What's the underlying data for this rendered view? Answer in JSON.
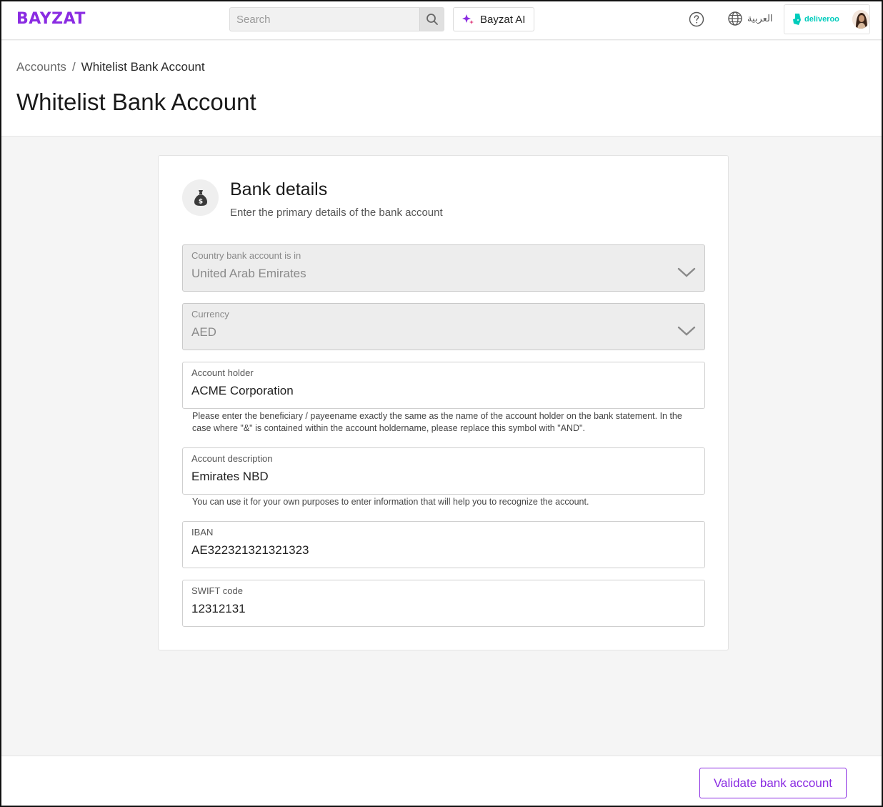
{
  "header": {
    "logo": "BAYZAT",
    "search_placeholder": "Search",
    "ai_label": "Bayzat AI",
    "language_label": "العربية",
    "company_name": "deliveroo"
  },
  "breadcrumb": {
    "parent": "Accounts",
    "separator": "/",
    "current": "Whitelist Bank Account"
  },
  "page": {
    "title": "Whitelist Bank Account"
  },
  "bank_details": {
    "title": "Bank details",
    "subtitle": "Enter the primary details of the bank account",
    "fields": {
      "country": {
        "label": "Country bank account is in",
        "value": "United Arab Emirates"
      },
      "currency": {
        "label": "Currency",
        "value": "AED"
      },
      "account_holder": {
        "label": "Account holder",
        "value": "ACME Corporation",
        "hint": "Please enter the beneficiary / payeename exactly the same as the name of the account holder on the bank statement. In the case where \"&\" is contained within the account holdername, please replace this symbol with \"AND\"."
      },
      "account_description": {
        "label": "Account description",
        "value": "Emirates NBD",
        "hint": "You can use it for your own purposes to enter information that will help you to recognize the account."
      },
      "iban": {
        "label": "IBAN",
        "value": "AE322321321321323"
      },
      "swift": {
        "label": "SWIFT code",
        "value": "12312131"
      }
    }
  },
  "footer": {
    "validate_label": "Validate bank account"
  },
  "colors": {
    "brand": "#8a2be2",
    "deliveroo": "#00ccbc"
  }
}
